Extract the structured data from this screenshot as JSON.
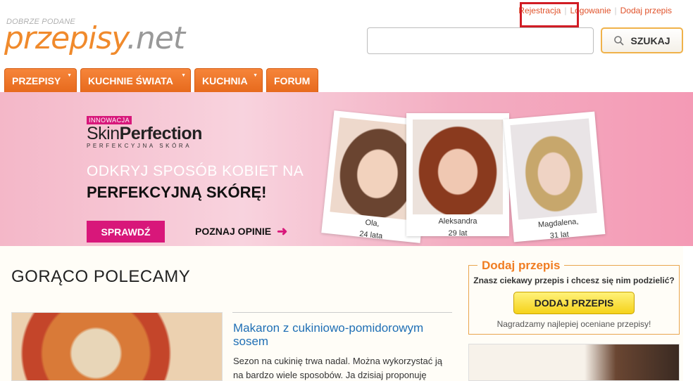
{
  "header": {
    "tagline": "DOBRZE PODANE",
    "logo_main": "przepisy",
    "logo_ext": ".net",
    "links": {
      "register": "Rejestracja",
      "login": "Logowanie",
      "add_recipe": "Dodaj przepis"
    },
    "search": {
      "placeholder": "",
      "button_label": "SZUKAJ"
    }
  },
  "nav": {
    "items": [
      "PRZEPISY",
      "KUCHNIE ŚWIATA",
      "KUCHNIA",
      "FORUM"
    ]
  },
  "banner": {
    "badge": "INNOWACJA",
    "brand_a": "Skin",
    "brand_b": "Perfection",
    "brand_sub": "PERFEKCYJNA SKÓRA",
    "headline_1": "ODKRYJ SPOSÓB KOBIET NA",
    "headline_2": "PERFEKCYJNĄ SKÓRĘ!",
    "cta": "SPRAWDŹ",
    "cta_secondary": "POZNAJ OPINIE",
    "people": [
      {
        "name": "Ola,",
        "age": "24 lata"
      },
      {
        "name": "Aleksandra",
        "age": "29 lat"
      },
      {
        "name": "Magdalena,",
        "age": "31 lat"
      }
    ]
  },
  "main": {
    "section_title": "GORĄCO POLECAMY",
    "recipe": {
      "title": "Makaron z cukiniowo-pomidorowym sosem",
      "excerpt": "Sezon na cukinię trwa nadal. Można wykorzystać ją na bardzo wiele sposobów. Ja dzisiaj proponuję"
    }
  },
  "sidebar": {
    "add_box": {
      "title": "Dodaj przepis",
      "question": "Znasz ciekawy przepis i chcesz się nim podzielić?",
      "button": "DODAJ PRZEPIS",
      "note": "Nagradzamy najlepiej oceniane przepisy!"
    }
  },
  "colors": {
    "brand_orange": "#f08a2c",
    "accent_red": "#e0522a",
    "banner_pink": "#d8177a",
    "link_blue": "#1f6fb5"
  }
}
